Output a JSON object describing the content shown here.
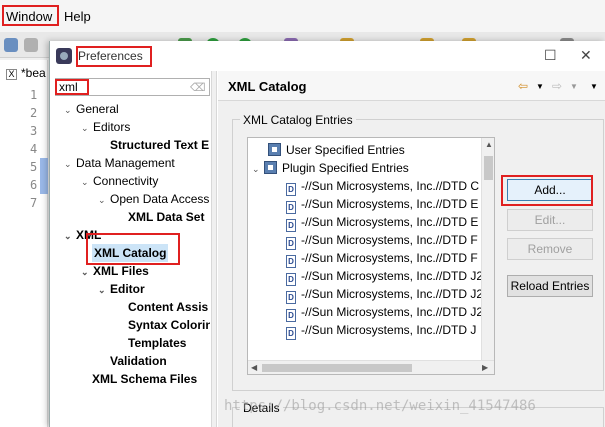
{
  "menubar": {
    "window": "Window",
    "help": "Help"
  },
  "editor": {
    "tab": "*bea",
    "lines": [
      "1",
      "2",
      "3",
      "4",
      "5",
      "6",
      "7"
    ]
  },
  "dialog": {
    "title": "Preferences",
    "filter_value": "xml",
    "tree": [
      {
        "label": "General",
        "twisty": "⌄"
      },
      {
        "label": "Editors",
        "twisty": "⌄"
      },
      {
        "label": "Structured Text E",
        "twisty": ""
      },
      {
        "label": "Data Management",
        "twisty": "⌄"
      },
      {
        "label": "Connectivity",
        "twisty": "⌄"
      },
      {
        "label": "Open Data Access",
        "twisty": "⌄"
      },
      {
        "label": "XML Data Set",
        "twisty": ""
      },
      {
        "label": "XML",
        "twisty": "⌄"
      },
      {
        "label": "XML Catalog",
        "twisty": ""
      },
      {
        "label": "XML Files",
        "twisty": "⌄"
      },
      {
        "label": "Editor",
        "twisty": "⌄"
      },
      {
        "label": "Content Assis",
        "twisty": ""
      },
      {
        "label": "Syntax Colorin",
        "twisty": ""
      },
      {
        "label": "Templates",
        "twisty": ""
      },
      {
        "label": "Validation",
        "twisty": ""
      },
      {
        "label": "XML Schema Files",
        "twisty": ""
      }
    ],
    "panel": {
      "title": "XML Catalog",
      "group_label": "XML Catalog Entries",
      "entries": [
        {
          "label": "User Specified Entries",
          "twisty": "",
          "kind": "catalog"
        },
        {
          "label": "Plugin Specified Entries",
          "twisty": "⌄",
          "kind": "catalog"
        },
        {
          "label": "-//Sun Microsystems, Inc.//DTD C",
          "kind": "dtd"
        },
        {
          "label": "-//Sun Microsystems, Inc.//DTD E",
          "kind": "dtd"
        },
        {
          "label": "-//Sun Microsystems, Inc.//DTD E",
          "kind": "dtd"
        },
        {
          "label": "-//Sun Microsystems, Inc.//DTD F",
          "kind": "dtd"
        },
        {
          "label": "-//Sun Microsystems, Inc.//DTD F",
          "kind": "dtd"
        },
        {
          "label": "-//Sun Microsystems, Inc.//DTD J2",
          "kind": "dtd"
        },
        {
          "label": "-//Sun Microsystems, Inc.//DTD J2",
          "kind": "dtd"
        },
        {
          "label": "-//Sun Microsystems, Inc.//DTD J2",
          "kind": "dtd"
        },
        {
          "label": "-//Sun Microsystems, Inc.//DTD J",
          "kind": "dtd"
        }
      ],
      "buttons": {
        "add": "Add...",
        "edit": "Edit...",
        "remove": "Remove",
        "reload": "Reload Entries"
      },
      "details_label": "Details"
    }
  },
  "watermark": "https://blog.csdn.net/weixin_41547486",
  "colors": {
    "highlight": "#e02020",
    "selection": "#cce4f7"
  }
}
